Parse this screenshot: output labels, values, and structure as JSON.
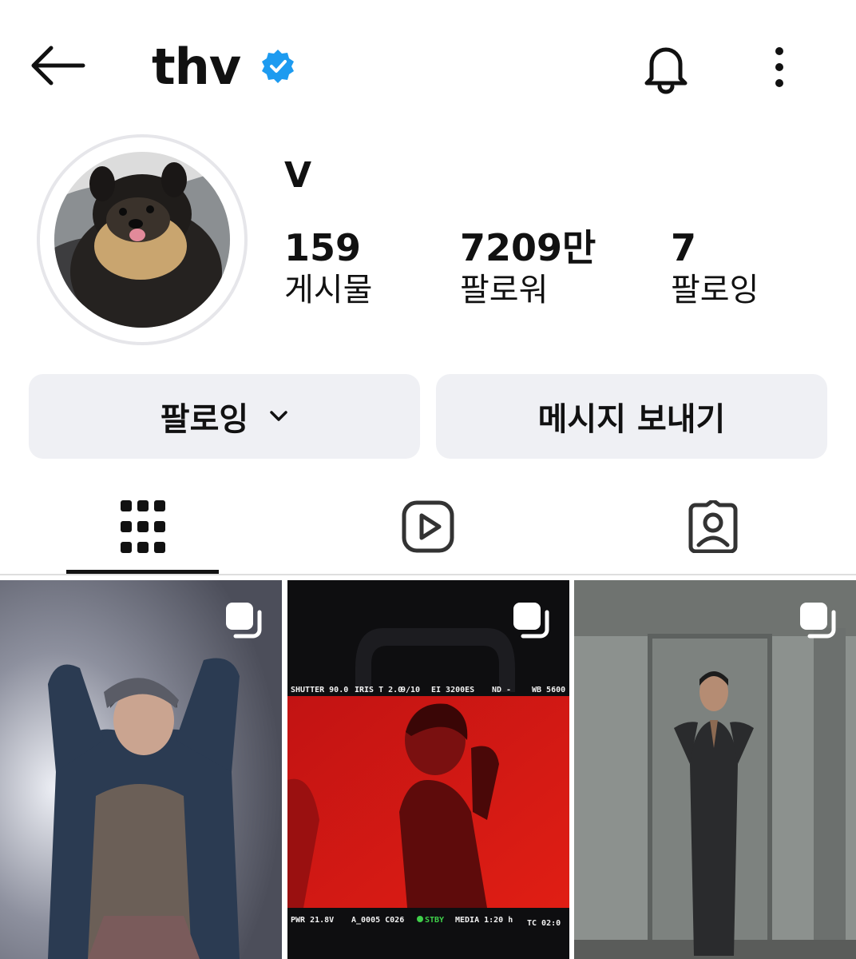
{
  "header": {
    "username": "thv"
  },
  "profile": {
    "display_name": "V",
    "stats": [
      {
        "value": "159",
        "label": "게시물"
      },
      {
        "value": "7209만",
        "label": "팔로워"
      },
      {
        "value": "7",
        "label": "팔로잉"
      }
    ]
  },
  "actions": {
    "following_label": "팔로잉",
    "message_label": "메시지 보내기"
  },
  "tabs": [
    {
      "name": "grid",
      "icon": "grid-icon",
      "selected": true
    },
    {
      "name": "reels",
      "icon": "reels-icon",
      "selected": false
    },
    {
      "name": "tagged",
      "icon": "tagged-icon",
      "selected": false
    }
  ],
  "posts": [
    {
      "icon": "multiple-photos-icon"
    },
    {
      "icon": "multiple-photos-icon",
      "monitor": {
        "shutter": "SHUTTER 90.0",
        "iris": "IRIS T 2.0",
        "frame": "9/10",
        "ei": "EI 3200ES",
        "nd": "ND -",
        "wb": "WB 5600",
        "pwr": "PWR 21.8V",
        "clip": "A_0005 C026",
        "stby": "STBY",
        "media": "MEDIA 1:20 h",
        "tc": "TC 02:0"
      }
    },
    {
      "icon": "multiple-photos-icon"
    }
  ],
  "colors": {
    "verified": "#1d9bf0",
    "button_bg": "#eff0f4",
    "text": "#111111"
  }
}
